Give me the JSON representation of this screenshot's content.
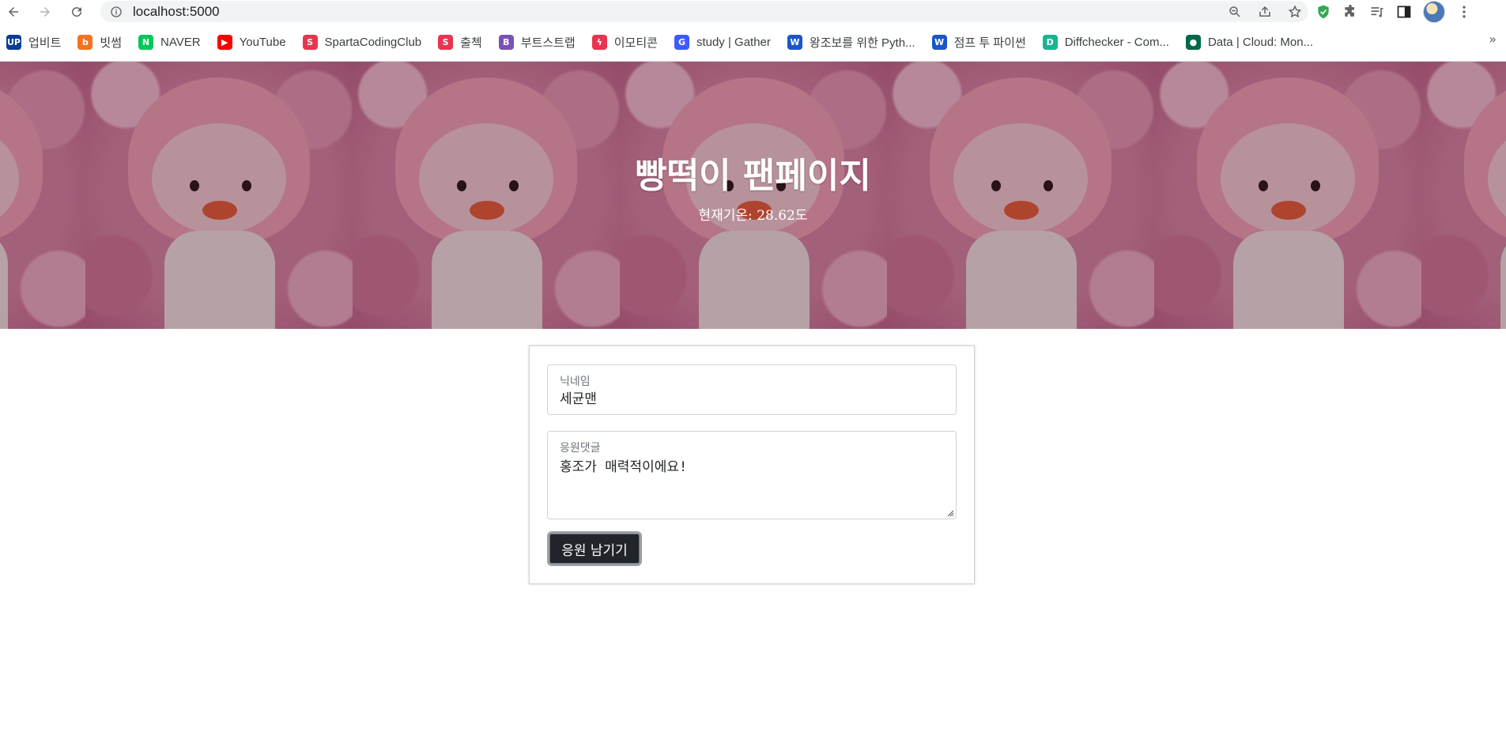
{
  "browser": {
    "url": "localhost:5000"
  },
  "icons": {
    "back": "arrow-left-icon",
    "forward": "arrow-right-icon",
    "reload": "reload-icon",
    "site_info": "info-icon",
    "zoom": "zoom-out-icon",
    "share": "share-icon",
    "star": "star-icon",
    "shield": "shield-icon",
    "extensions": "puzzle-icon",
    "reading_list": "reading-list-icon",
    "side_panel": "side-panel-icon",
    "menu": "kebab-menu-icon"
  },
  "bookmarks": [
    {
      "label": "업비트",
      "color": "#0a3d91",
      "glyph": "UP"
    },
    {
      "label": "빗썸",
      "color": "#f37321",
      "glyph": "b"
    },
    {
      "label": "NAVER",
      "color": "#03c75a",
      "glyph": "N"
    },
    {
      "label": "YouTube",
      "color": "#ff0000",
      "glyph": "▶"
    },
    {
      "label": "SpartaCodingClub",
      "color": "#e8344e",
      "glyph": "S"
    },
    {
      "label": "출첵",
      "color": "#e8344e",
      "glyph": "S"
    },
    {
      "label": "부트스트랩",
      "color": "#7952b3",
      "glyph": "B"
    },
    {
      "label": "이모티콘",
      "color": "#e8344e",
      "glyph": "ϟ"
    },
    {
      "label": "study | Gather",
      "color": "#3c5aff",
      "glyph": "G"
    },
    {
      "label": "왕조보를 위한 Pyth...",
      "color": "#1a56c8",
      "glyph": "W"
    },
    {
      "label": "점프 투 파이썬",
      "color": "#1a56c8",
      "glyph": "W"
    },
    {
      "label": "Diffchecker - Com...",
      "color": "#19b48f",
      "glyph": "D"
    },
    {
      "label": "Data | Cloud: Mon...",
      "color": "#00684a",
      "glyph": "●"
    }
  ],
  "bookmarks_more": "»",
  "hero": {
    "title": "빵떡이 팬페이지",
    "temperature": "현재기온: 28.62도"
  },
  "form": {
    "nickname_label": "닉네임",
    "nickname_value": "세균맨",
    "comment_label": "응원댓글",
    "comment_value": "홍조가 매력적이에요!",
    "submit_label": "응원 남기기"
  }
}
